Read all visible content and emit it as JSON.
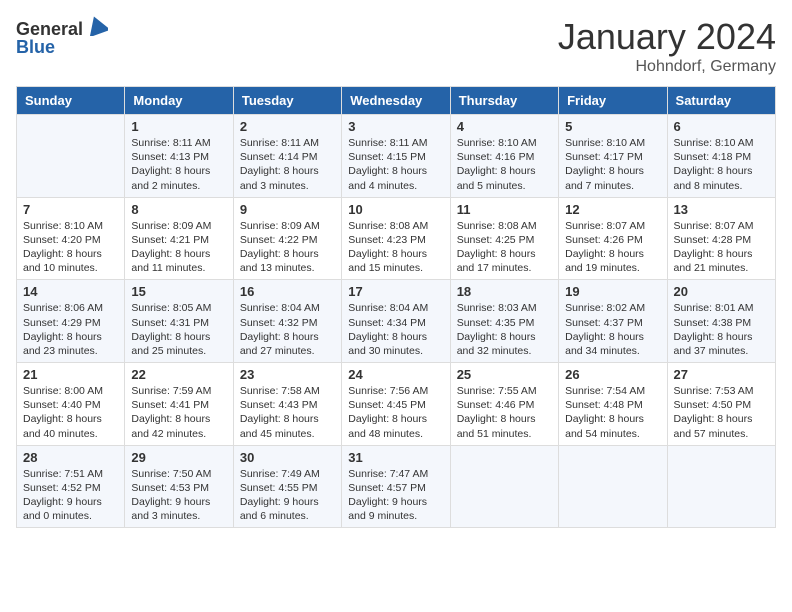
{
  "logo": {
    "general": "General",
    "blue": "Blue"
  },
  "title": "January 2024",
  "subtitle": "Hohndorf, Germany",
  "days_of_week": [
    "Sunday",
    "Monday",
    "Tuesday",
    "Wednesday",
    "Thursday",
    "Friday",
    "Saturday"
  ],
  "weeks": [
    [
      {
        "day": "",
        "sunrise": "",
        "sunset": "",
        "daylight": ""
      },
      {
        "day": "1",
        "sunrise": "Sunrise: 8:11 AM",
        "sunset": "Sunset: 4:13 PM",
        "daylight": "Daylight: 8 hours and 2 minutes."
      },
      {
        "day": "2",
        "sunrise": "Sunrise: 8:11 AM",
        "sunset": "Sunset: 4:14 PM",
        "daylight": "Daylight: 8 hours and 3 minutes."
      },
      {
        "day": "3",
        "sunrise": "Sunrise: 8:11 AM",
        "sunset": "Sunset: 4:15 PM",
        "daylight": "Daylight: 8 hours and 4 minutes."
      },
      {
        "day": "4",
        "sunrise": "Sunrise: 8:10 AM",
        "sunset": "Sunset: 4:16 PM",
        "daylight": "Daylight: 8 hours and 5 minutes."
      },
      {
        "day": "5",
        "sunrise": "Sunrise: 8:10 AM",
        "sunset": "Sunset: 4:17 PM",
        "daylight": "Daylight: 8 hours and 7 minutes."
      },
      {
        "day": "6",
        "sunrise": "Sunrise: 8:10 AM",
        "sunset": "Sunset: 4:18 PM",
        "daylight": "Daylight: 8 hours and 8 minutes."
      }
    ],
    [
      {
        "day": "7",
        "sunrise": "Sunrise: 8:10 AM",
        "sunset": "Sunset: 4:20 PM",
        "daylight": "Daylight: 8 hours and 10 minutes."
      },
      {
        "day": "8",
        "sunrise": "Sunrise: 8:09 AM",
        "sunset": "Sunset: 4:21 PM",
        "daylight": "Daylight: 8 hours and 11 minutes."
      },
      {
        "day": "9",
        "sunrise": "Sunrise: 8:09 AM",
        "sunset": "Sunset: 4:22 PM",
        "daylight": "Daylight: 8 hours and 13 minutes."
      },
      {
        "day": "10",
        "sunrise": "Sunrise: 8:08 AM",
        "sunset": "Sunset: 4:23 PM",
        "daylight": "Daylight: 8 hours and 15 minutes."
      },
      {
        "day": "11",
        "sunrise": "Sunrise: 8:08 AM",
        "sunset": "Sunset: 4:25 PM",
        "daylight": "Daylight: 8 hours and 17 minutes."
      },
      {
        "day": "12",
        "sunrise": "Sunrise: 8:07 AM",
        "sunset": "Sunset: 4:26 PM",
        "daylight": "Daylight: 8 hours and 19 minutes."
      },
      {
        "day": "13",
        "sunrise": "Sunrise: 8:07 AM",
        "sunset": "Sunset: 4:28 PM",
        "daylight": "Daylight: 8 hours and 21 minutes."
      }
    ],
    [
      {
        "day": "14",
        "sunrise": "Sunrise: 8:06 AM",
        "sunset": "Sunset: 4:29 PM",
        "daylight": "Daylight: 8 hours and 23 minutes."
      },
      {
        "day": "15",
        "sunrise": "Sunrise: 8:05 AM",
        "sunset": "Sunset: 4:31 PM",
        "daylight": "Daylight: 8 hours and 25 minutes."
      },
      {
        "day": "16",
        "sunrise": "Sunrise: 8:04 AM",
        "sunset": "Sunset: 4:32 PM",
        "daylight": "Daylight: 8 hours and 27 minutes."
      },
      {
        "day": "17",
        "sunrise": "Sunrise: 8:04 AM",
        "sunset": "Sunset: 4:34 PM",
        "daylight": "Daylight: 8 hours and 30 minutes."
      },
      {
        "day": "18",
        "sunrise": "Sunrise: 8:03 AM",
        "sunset": "Sunset: 4:35 PM",
        "daylight": "Daylight: 8 hours and 32 minutes."
      },
      {
        "day": "19",
        "sunrise": "Sunrise: 8:02 AM",
        "sunset": "Sunset: 4:37 PM",
        "daylight": "Daylight: 8 hours and 34 minutes."
      },
      {
        "day": "20",
        "sunrise": "Sunrise: 8:01 AM",
        "sunset": "Sunset: 4:38 PM",
        "daylight": "Daylight: 8 hours and 37 minutes."
      }
    ],
    [
      {
        "day": "21",
        "sunrise": "Sunrise: 8:00 AM",
        "sunset": "Sunset: 4:40 PM",
        "daylight": "Daylight: 8 hours and 40 minutes."
      },
      {
        "day": "22",
        "sunrise": "Sunrise: 7:59 AM",
        "sunset": "Sunset: 4:41 PM",
        "daylight": "Daylight: 8 hours and 42 minutes."
      },
      {
        "day": "23",
        "sunrise": "Sunrise: 7:58 AM",
        "sunset": "Sunset: 4:43 PM",
        "daylight": "Daylight: 8 hours and 45 minutes."
      },
      {
        "day": "24",
        "sunrise": "Sunrise: 7:56 AM",
        "sunset": "Sunset: 4:45 PM",
        "daylight": "Daylight: 8 hours and 48 minutes."
      },
      {
        "day": "25",
        "sunrise": "Sunrise: 7:55 AM",
        "sunset": "Sunset: 4:46 PM",
        "daylight": "Daylight: 8 hours and 51 minutes."
      },
      {
        "day": "26",
        "sunrise": "Sunrise: 7:54 AM",
        "sunset": "Sunset: 4:48 PM",
        "daylight": "Daylight: 8 hours and 54 minutes."
      },
      {
        "day": "27",
        "sunrise": "Sunrise: 7:53 AM",
        "sunset": "Sunset: 4:50 PM",
        "daylight": "Daylight: 8 hours and 57 minutes."
      }
    ],
    [
      {
        "day": "28",
        "sunrise": "Sunrise: 7:51 AM",
        "sunset": "Sunset: 4:52 PM",
        "daylight": "Daylight: 9 hours and 0 minutes."
      },
      {
        "day": "29",
        "sunrise": "Sunrise: 7:50 AM",
        "sunset": "Sunset: 4:53 PM",
        "daylight": "Daylight: 9 hours and 3 minutes."
      },
      {
        "day": "30",
        "sunrise": "Sunrise: 7:49 AM",
        "sunset": "Sunset: 4:55 PM",
        "daylight": "Daylight: 9 hours and 6 minutes."
      },
      {
        "day": "31",
        "sunrise": "Sunrise: 7:47 AM",
        "sunset": "Sunset: 4:57 PM",
        "daylight": "Daylight: 9 hours and 9 minutes."
      },
      {
        "day": "",
        "sunrise": "",
        "sunset": "",
        "daylight": ""
      },
      {
        "day": "",
        "sunrise": "",
        "sunset": "",
        "daylight": ""
      },
      {
        "day": "",
        "sunrise": "",
        "sunset": "",
        "daylight": ""
      }
    ]
  ]
}
